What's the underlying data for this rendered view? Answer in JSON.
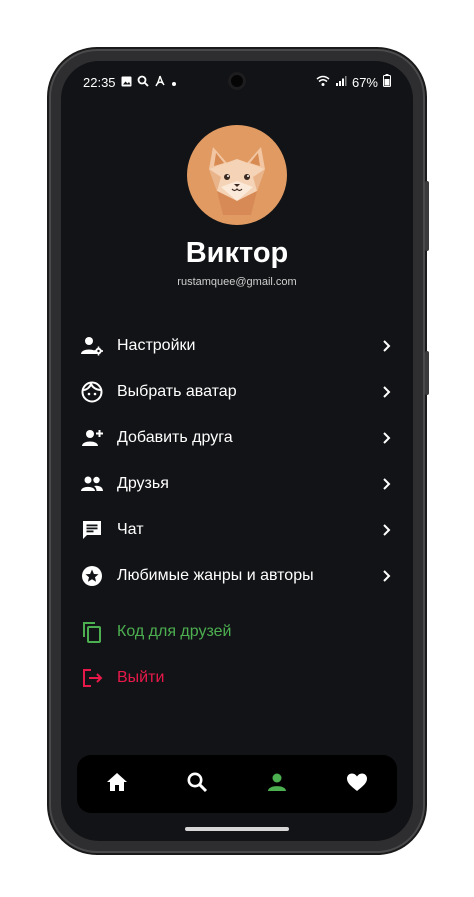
{
  "status_bar": {
    "time": "22:35",
    "battery": "67%",
    "icons": [
      "image-icon",
      "search-icon",
      "pdf-icon",
      "dot-icon",
      "wifi-icon",
      "signal-icon",
      "battery-icon"
    ]
  },
  "profile": {
    "name": "Виктор",
    "email": "rustamquee@gmail.com",
    "avatar_icon": "fox-avatar-icon"
  },
  "menu": {
    "items": [
      {
        "label": "Настройки",
        "icon": "user-gear-icon"
      },
      {
        "label": "Выбрать аватар",
        "icon": "face-icon"
      },
      {
        "label": "Добавить друга",
        "icon": "person-add-icon"
      },
      {
        "label": "Друзья",
        "icon": "people-icon"
      },
      {
        "label": "Чат",
        "icon": "chat-icon"
      },
      {
        "label": "Любимые жанры и авторы",
        "icon": "star-circle-icon"
      }
    ],
    "friend_code": {
      "label": "Код для друзей",
      "icon": "copy-icon",
      "color": "#4caf50"
    },
    "logout": {
      "label": "Выйти",
      "icon": "logout-icon",
      "color": "#e8194a"
    }
  },
  "tab_bar": {
    "tabs": [
      {
        "name": "home",
        "icon": "home-icon",
        "active": false
      },
      {
        "name": "search",
        "icon": "search-icon",
        "active": false
      },
      {
        "name": "profile",
        "icon": "person-icon",
        "active": true,
        "color": "#4caf50"
      },
      {
        "name": "favorites",
        "icon": "heart-icon",
        "active": false
      }
    ]
  },
  "colors": {
    "background": "#121316",
    "tabbar": "#000000",
    "accent_green": "#4caf50",
    "accent_red": "#e8194a",
    "avatar_bg": "#e09a62"
  }
}
